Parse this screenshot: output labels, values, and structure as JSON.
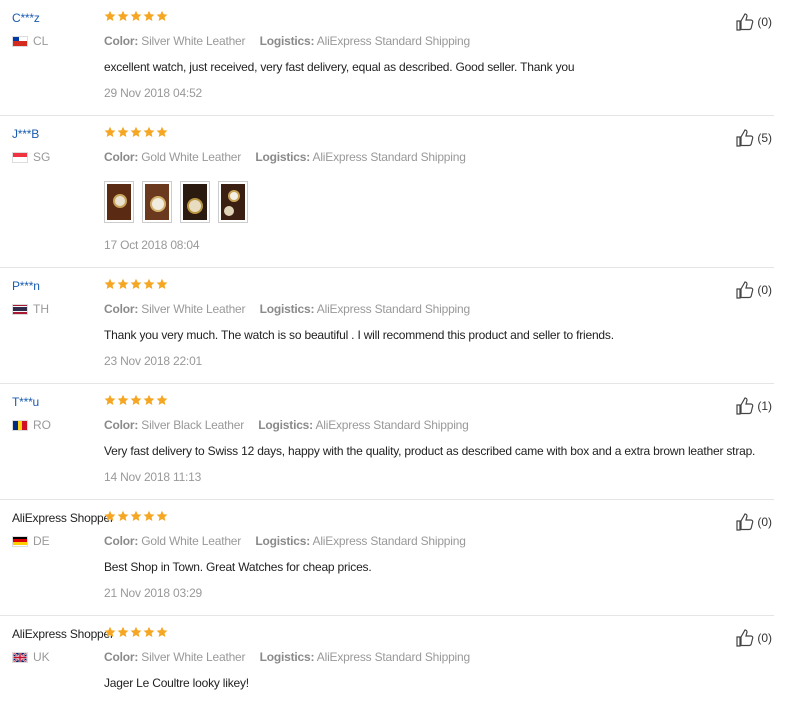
{
  "labels": {
    "color": "Color:",
    "logistics": "Logistics:"
  },
  "reviews": [
    {
      "user": "C***z",
      "user_style": "link",
      "country": "CL",
      "flag": "chile",
      "stars": 5,
      "color": "Silver White Leather",
      "logistics": "AliExpress Standard Shipping",
      "feedback": "excellent watch, just received, very fast delivery, equal as described. Good seller. Thank you",
      "date": "29 Nov 2018 04:52",
      "likes": "(0)",
      "photos": 0
    },
    {
      "user": "J***B",
      "user_style": "link",
      "country": "SG",
      "flag": "singapore",
      "stars": 5,
      "color": "Gold White Leather",
      "logistics": "AliExpress Standard Shipping",
      "feedback": "",
      "date": "17 Oct 2018 08:04",
      "likes": "(5)",
      "photos": 4
    },
    {
      "user": "P***n",
      "user_style": "link",
      "country": "TH",
      "flag": "thailand",
      "stars": 5,
      "color": "Silver White Leather",
      "logistics": "AliExpress Standard Shipping",
      "feedback": "Thank you very much. The watch is so beautiful . I will recommend this product and seller to friends.",
      "date": "23 Nov 2018 22:01",
      "likes": "(0)",
      "photos": 0
    },
    {
      "user": "T***u",
      "user_style": "link",
      "country": "RO",
      "flag": "romania",
      "stars": 5,
      "color": "Silver Black Leather",
      "logistics": "AliExpress Standard Shipping",
      "feedback": "Very fast delivery to Swiss 12 days, happy with the quality, product as described came with box and a extra brown leather strap.",
      "date": "14 Nov 2018 11:13",
      "likes": "(1)",
      "photos": 0
    },
    {
      "user": "AliExpress Shopper",
      "user_style": "plain",
      "country": "DE",
      "flag": "germany",
      "stars": 5,
      "color": "Gold White Leather",
      "logistics": "AliExpress Standard Shipping",
      "feedback": "Best Shop in Town. Great Watches for cheap prices.",
      "date": "21 Nov 2018 03:29",
      "likes": "(0)",
      "photos": 0
    },
    {
      "user": "AliExpress Shopper",
      "user_style": "plain",
      "country": "UK",
      "flag": "uk",
      "stars": 5,
      "color": "Silver White Leather",
      "logistics": "AliExpress Standard Shipping",
      "feedback": "Jager Le Coultre looky likey!",
      "date": "",
      "likes": "(0)",
      "photos": 0
    }
  ],
  "colors": {
    "star": "#f5a623",
    "link": "#1a5cb0",
    "meta": "#999999",
    "divider": "#e5e5e5"
  }
}
